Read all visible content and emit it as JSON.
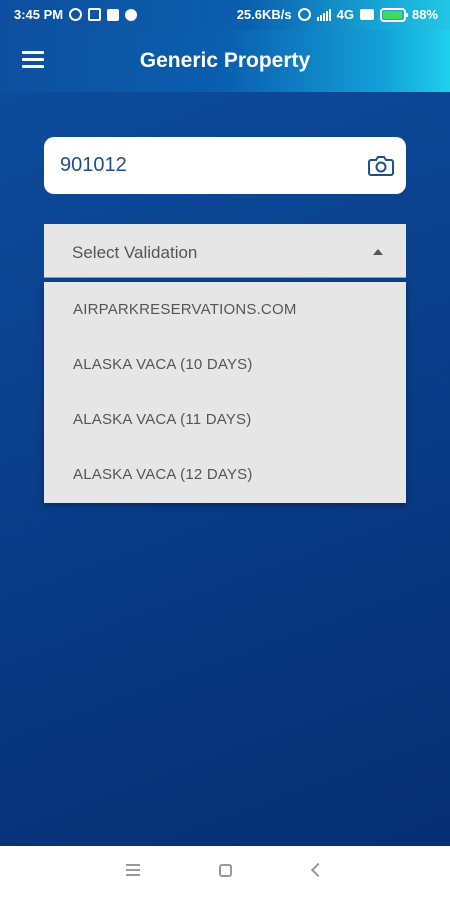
{
  "status_bar": {
    "time": "3:45 PM",
    "network_speed": "25.6KB/s",
    "network_type": "4G",
    "battery_percent": "88%",
    "battery_level": 0.88
  },
  "app_bar": {
    "title": "Generic Property",
    "menu_icon": "hamburger-menu-icon"
  },
  "property_input": {
    "value": "901012",
    "camera_icon": "camera-icon"
  },
  "validation_select": {
    "label": "Select Validation",
    "options": [
      "AIRPARKRESERVATIONS.COM",
      "ALASKA VACA (10 DAYS)",
      "ALASKA VACA (11 DAYS)",
      "ALASKA VACA (12 DAYS)"
    ]
  },
  "nav_bar": {
    "icons": [
      "menu-icon",
      "home-icon",
      "back-icon"
    ]
  },
  "colors": {
    "background_top": "#0d4f9e",
    "background_bottom": "#062e72",
    "appbar_accent": "#1ed0ec",
    "input_text": "#1e4f8f",
    "dropdown_bg": "#e6e6e6"
  }
}
